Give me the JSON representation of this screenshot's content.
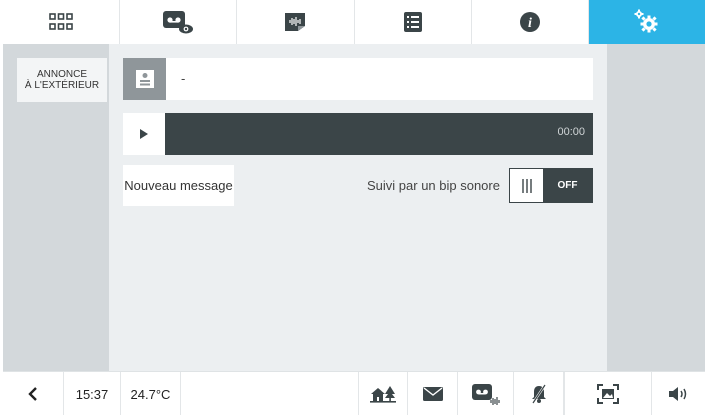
{
  "top_tabs": [
    {
      "name": "apps-grid-icon",
      "active": false
    },
    {
      "name": "answering-machine-view-icon",
      "active": false
    },
    {
      "name": "voice-memo-icon",
      "active": false
    },
    {
      "name": "list-icon",
      "active": false
    },
    {
      "name": "info-icon",
      "active": false
    },
    {
      "name": "settings-gears-icon",
      "active": true
    }
  ],
  "sidebar": {
    "items": [
      {
        "label": "ANNONCE\nÀ L'EXTÉRIEUR",
        "selected": true
      }
    ]
  },
  "message": {
    "name_value": "-"
  },
  "player": {
    "time": "00:00"
  },
  "actions": {
    "new_message_label": "Nouveau message"
  },
  "beep": {
    "label": "Suivi par un bip sonore",
    "state": "OFF"
  },
  "statusbar": {
    "time": "15:37",
    "temperature": "24.7°C",
    "icons": [
      "back-icon",
      "home-trees-icon",
      "mail-icon",
      "answering-machine-icon",
      "bell-muted-icon",
      "image-frame-icon",
      "speaker-icon"
    ]
  },
  "colors": {
    "accent": "#2cb4e6",
    "dark": "#3b4548",
    "panel": "#d3d8db",
    "background": "#eceff1"
  }
}
